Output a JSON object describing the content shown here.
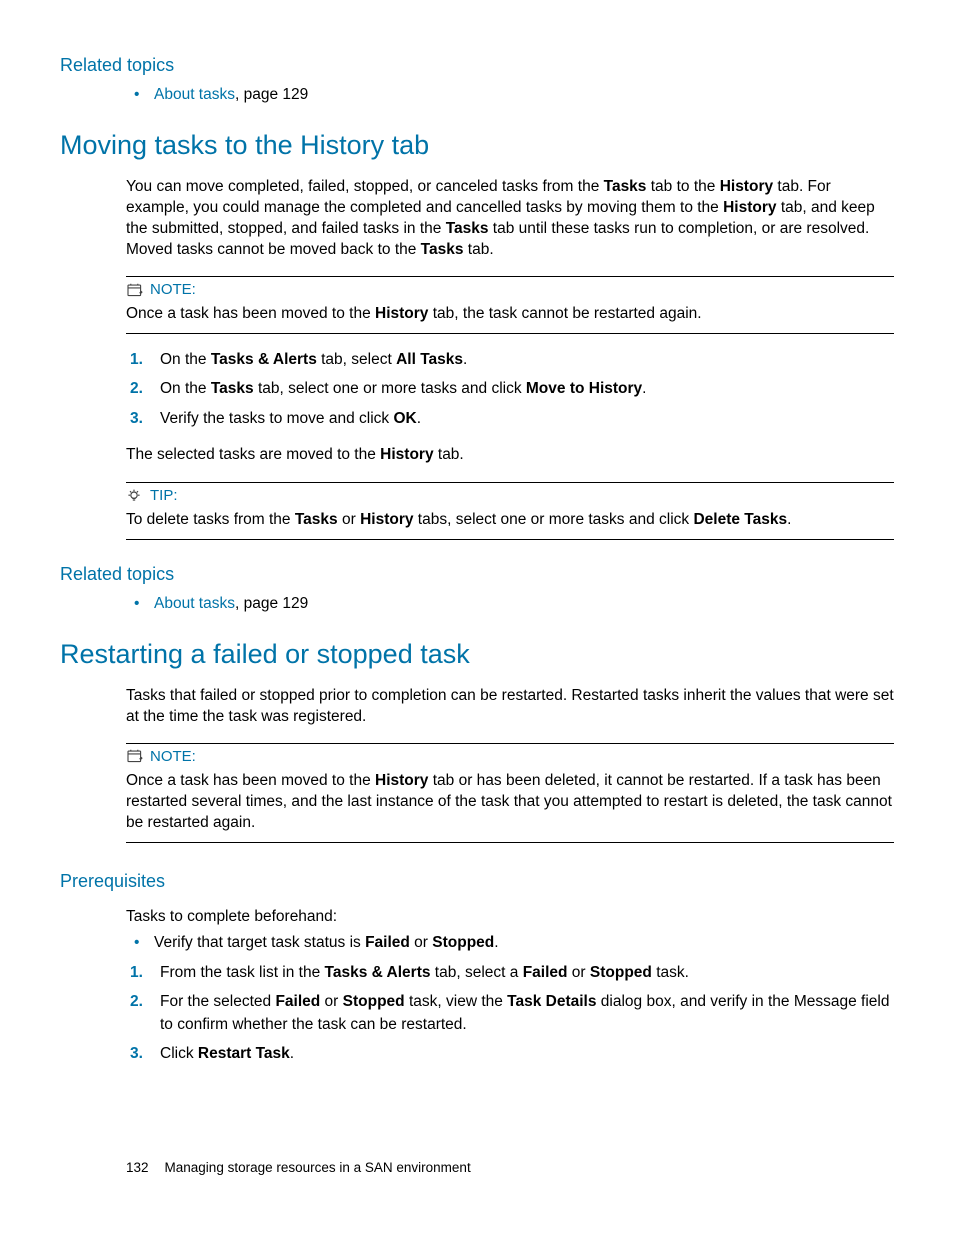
{
  "related1": {
    "heading": "Related topics",
    "item_link": "About tasks",
    "item_tail": ", page 129"
  },
  "sec1": {
    "heading": "Moving tasks to the History tab",
    "p1a": "You can move completed, failed, stopped, or canceled tasks from the ",
    "p1b": "Tasks",
    "p1c": " tab to the ",
    "p1d": "History",
    "p1e": " tab. For example, you could manage the completed and cancelled tasks by moving them to the ",
    "p1f": "History",
    "p1g": " tab, and keep the submitted, stopped, and failed tasks in the ",
    "p1h": "Tasks",
    "p1i": " tab until these tasks run to completion, or are resolved. Moved tasks cannot be moved back to the ",
    "p1j": "Tasks",
    "p1k": " tab.",
    "note_label": "NOTE:",
    "note_a": "Once a task has been moved to the ",
    "note_b": "History",
    "note_c": " tab, the task cannot be restarted again.",
    "s1a": "On the ",
    "s1b": "Tasks & Alerts",
    "s1c": " tab, select ",
    "s1d": "All Tasks",
    "s1e": ".",
    "s2a": "On the ",
    "s2b": "Tasks",
    "s2c": " tab, select one or more tasks and click ",
    "s2d": "Move to History",
    "s2e": ".",
    "s3a": "Verify the tasks to move and click ",
    "s3b": "OK",
    "s3c": ".",
    "post_a": "The selected tasks are moved to the ",
    "post_b": "History",
    "post_c": " tab.",
    "tip_label": "TIP:",
    "tip_a": "To delete tasks from the ",
    "tip_b": "Tasks",
    "tip_c": " or ",
    "tip_d": "History",
    "tip_e": " tabs, select one or more tasks and click ",
    "tip_f": "Delete Tasks",
    "tip_g": "."
  },
  "related2": {
    "heading": "Related topics",
    "item_link": "About tasks",
    "item_tail": ", page 129"
  },
  "sec2": {
    "heading": "Restarting a failed or stopped task",
    "p1": "Tasks that failed or stopped prior to completion can be restarted. Restarted tasks inherit the values that were set at the time the task was registered.",
    "note_label": "NOTE:",
    "note_a": "Once a task has been moved to the ",
    "note_b": "History",
    "note_c": " tab or has been deleted, it cannot be restarted. If a task has been restarted several times, and the last instance of the task that you attempted to restart is deleted, the task cannot be restarted again."
  },
  "prereq": {
    "heading": "Prerequisites",
    "intro": "Tasks to complete beforehand:",
    "b_a": "Verify that target task status is ",
    "b_b": "Failed",
    "b_c": " or ",
    "b_d": "Stopped",
    "b_e": ".",
    "s1a": "From the task list in the ",
    "s1b": "Tasks & Alerts",
    "s1c": " tab, select a ",
    "s1d": "Failed",
    "s1e": " or ",
    "s1f": "Stopped",
    "s1g": " task.",
    "s2a": "For the selected ",
    "s2b": "Failed",
    "s2c": " or ",
    "s2d": "Stopped",
    "s2e": " task, view the ",
    "s2f": "Task Details",
    "s2g": " dialog box, and verify in the Message field to confirm whether the task can be restarted.",
    "s3a": "Click ",
    "s3b": "Restart Task",
    "s3c": "."
  },
  "footer": {
    "page": "132",
    "title": "Managing storage resources in a SAN environment"
  }
}
